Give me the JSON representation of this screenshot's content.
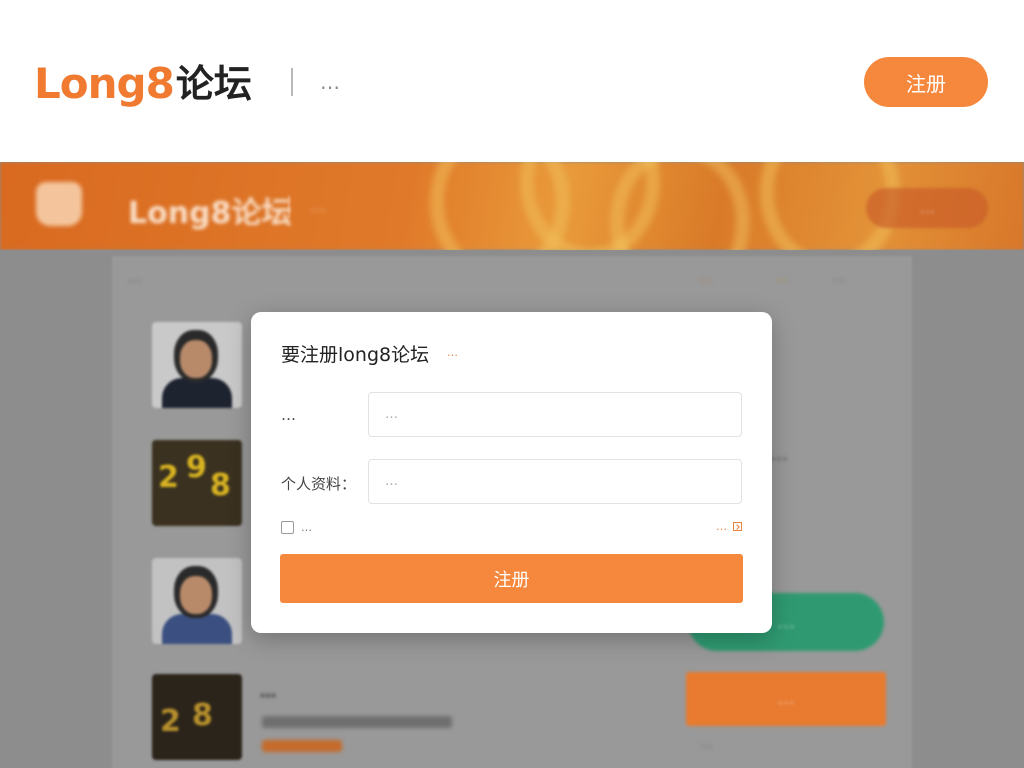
{
  "header": {
    "logo_latin": "Long8",
    "logo_cjk": "论坛",
    "tagline": "…",
    "register_label": "注册"
  },
  "background": {
    "banner_logo": "Long8论坛",
    "banner_tag": "…",
    "banner_button": "…",
    "breadcrumb": "…",
    "sort_options": [
      "…",
      "…",
      "…"
    ],
    "side_text": "…",
    "green_button": "…",
    "orange_button": "…",
    "list_title": "…",
    "bottom_links": "…"
  },
  "modal": {
    "title": "要注册long8论坛",
    "hint": "…",
    "fields": [
      {
        "label": "…",
        "placeholder": "…"
      },
      {
        "label": "个人资料：",
        "placeholder": "…"
      }
    ],
    "remember_label": "…",
    "link_label": "…",
    "submit_label": "注册"
  },
  "colors": {
    "accent": "#f5883d",
    "banner": "#e07a2a",
    "green": "#2f9a72"
  }
}
